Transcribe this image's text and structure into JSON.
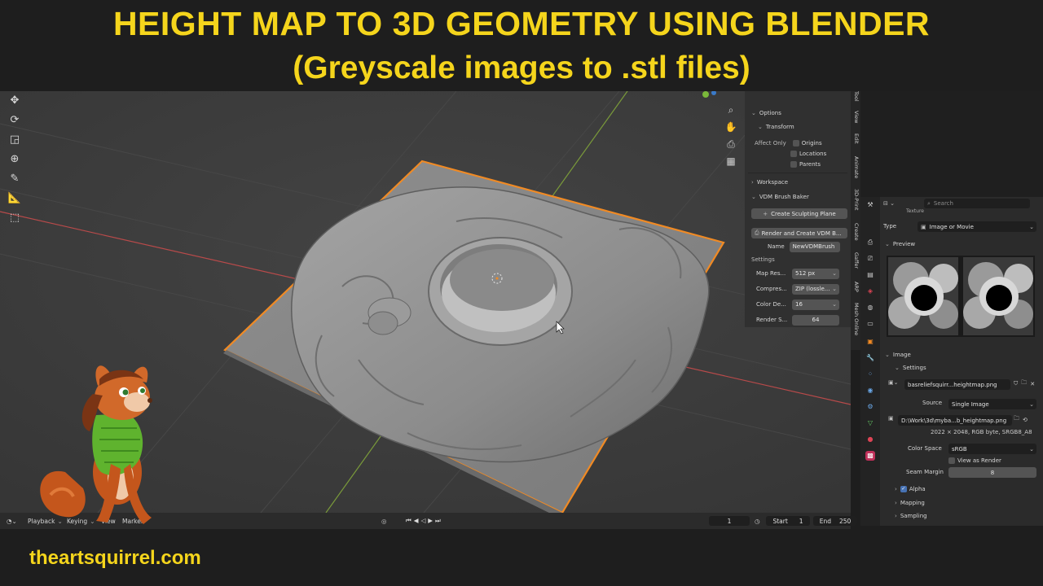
{
  "header": {
    "title_line1": "HEIGHT MAP TO 3D GEOMETRY USING BLENDER",
    "title_line2": "(Greyscale images to .stl files)"
  },
  "npanel": {
    "options_label": "Options",
    "transform_label": "Transform",
    "affect_only_label": "Affect Only",
    "origins_label": "Origins",
    "locations_label": "Locations",
    "parents_label": "Parents",
    "workspace_label": "Workspace",
    "vdm_label": "VDM Brush Baker",
    "create_plane_label": "Create Sculpting Plane",
    "render_create_label": "Render and Create VDM B...",
    "name_label": "Name",
    "name_value": "NewVDMBrush",
    "settings_label": "Settings",
    "map_res_label": "Map Res...",
    "map_res_value": "512 px",
    "compress_label": "Compres...",
    "compress_value": "ZIP (lossle...",
    "color_depth_label": "Color De...",
    "color_depth_value": "16",
    "render_samples_label": "Render S...",
    "render_samples_value": "64"
  },
  "side_tabs": [
    "Tool",
    "View",
    "Edit",
    "Animate",
    "3D-Print",
    "Create",
    "Gaffer",
    "ARP",
    "Mesh Online"
  ],
  "properties": {
    "search_placeholder": "Search",
    "texture_label": "Texture",
    "type_label": "Type",
    "type_value": "Image or Movie",
    "preview_label": "Preview",
    "image_label": "Image",
    "settings_label": "Settings",
    "image_file": "basreliefsquirr...heightmap.png",
    "source_label": "Source",
    "source_value": "Single Image",
    "filepath": "D:\\Work\\3d\\myba...b_heightmap.png",
    "image_info": "2022 × 2048,  RGB byte,  SRGB8_A8",
    "color_space_label": "Color Space",
    "color_space_value": "sRGB",
    "view_as_render_label": "View as Render",
    "seam_margin_label": "Seam Margin",
    "seam_margin_value": "8",
    "alpha_label": "Alpha",
    "mapping_label": "Mapping",
    "sampling_label": "Sampling"
  },
  "timeline": {
    "playback_label": "Playback",
    "keying_label": "Keying",
    "view_label": "View",
    "marker_label": "Marker",
    "current_frame": "1",
    "start_label": "Start",
    "start_value": "1",
    "end_label": "End",
    "end_value": "250"
  },
  "footer": {
    "site": "theartsquirrel.com"
  },
  "colors": {
    "title_yellow": "#f5d51c",
    "viewport_bg": "#3d3d3d",
    "selection_orange": "#f08a24",
    "mesh_grey": "#8a8a8a",
    "x_axis_red": "#b84a4a",
    "y_axis_green": "#7a9a3a"
  }
}
